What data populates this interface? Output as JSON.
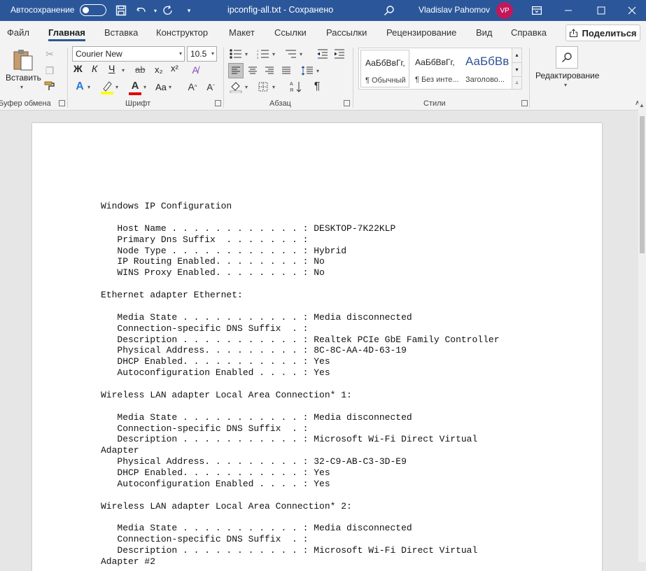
{
  "titlebar": {
    "autosave_label": "Автосохранение",
    "doc_title": "ipconfig-all.txt  -  Сохранено",
    "user_name": "Vladislav Pahomov",
    "avatar_initials": "VP"
  },
  "tabs": [
    "Файл",
    "Главная",
    "Вставка",
    "Конструктор",
    "Макет",
    "Ссылки",
    "Рассылки",
    "Рецензирование",
    "Вид",
    "Справка"
  ],
  "share_label": "Поделиться",
  "clipboard": {
    "paste_label": "Вставить",
    "group_label": "Буфер обмена"
  },
  "font": {
    "name": "Courier New",
    "size": "10.5",
    "group_label": "Шрифт",
    "bold": "Ж",
    "italic": "К",
    "underline": "Ч",
    "strike": "ab",
    "sub": "x₂",
    "sup": "x²",
    "case_label": "Aa"
  },
  "paragraph": {
    "group_label": "Абзац"
  },
  "styles": {
    "group_label": "Стили",
    "items": [
      {
        "preview": "АаБбВвГг,",
        "name": "¶ Обычный"
      },
      {
        "preview": "АаБбВвГг,",
        "name": "¶ Без инте..."
      },
      {
        "preview": "АаБбВв",
        "name": "Заголово..."
      }
    ],
    "heading_color": "#2f5496"
  },
  "editing": {
    "label": "Редактирование"
  },
  "document": {
    "text": "Windows IP Configuration\n\n   Host Name . . . . . . . . . . . . : DESKTOP-7K22KLP\n   Primary Dns Suffix  . . . . . . . :\n   Node Type . . . . . . . . . . . . : Hybrid\n   IP Routing Enabled. . . . . . . . : No\n   WINS Proxy Enabled. . . . . . . . : No\n\nEthernet adapter Ethernet:\n\n   Media State . . . . . . . . . . . : Media disconnected\n   Connection-specific DNS Suffix  . :\n   Description . . . . . . . . . . . : Realtek PCIe GbE Family Controller\n   Physical Address. . . . . . . . . : 8C-8C-AA-4D-63-19\n   DHCP Enabled. . . . . . . . . . . : Yes\n   Autoconfiguration Enabled . . . . : Yes\n\nWireless LAN adapter Local Area Connection* 1:\n\n   Media State . . . . . . . . . . . : Media disconnected\n   Connection-specific DNS Suffix  . :\n   Description . . . . . . . . . . . : Microsoft Wi-Fi Direct Virtual\nAdapter\n   Physical Address. . . . . . . . . : 32-C9-AB-C3-3D-E9\n   DHCP Enabled. . . . . . . . . . . : Yes\n   Autoconfiguration Enabled . . . . : Yes\n\nWireless LAN adapter Local Area Connection* 2:\n\n   Media State . . . . . . . . . . . : Media disconnected\n   Connection-specific DNS Suffix  . :\n   Description . . . . . . . . . . . : Microsoft Wi-Fi Direct Virtual\nAdapter #2"
  },
  "colors": {
    "titlebar": "#2b579a",
    "avatar": "#c2185b",
    "highlight": "#ffff00",
    "font_color": "#e00000"
  }
}
